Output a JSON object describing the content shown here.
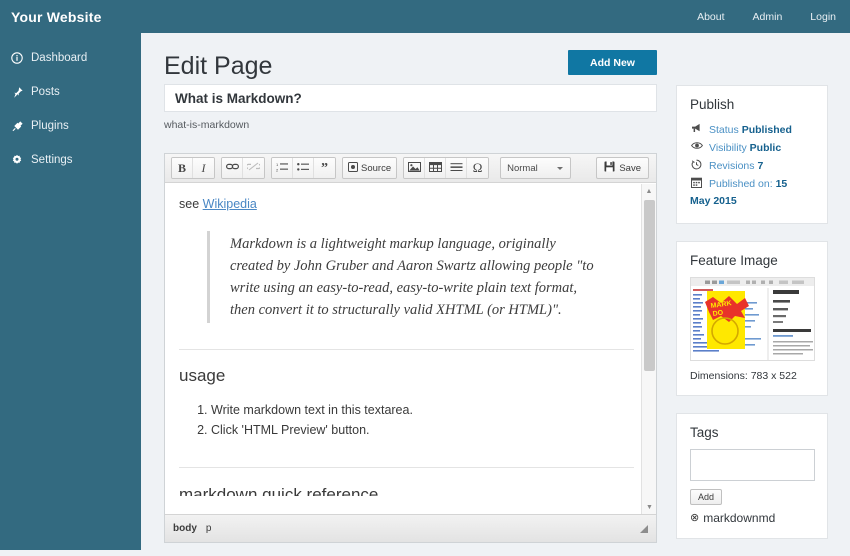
{
  "topbar": {
    "brand": "Your Website",
    "nav": [
      {
        "label": "About"
      },
      {
        "label": "Admin"
      },
      {
        "label": "Login"
      }
    ]
  },
  "sidebar": {
    "items": [
      {
        "label": "Dashboard",
        "icon": "info-circle-icon"
      },
      {
        "label": "Posts",
        "icon": "pushpin-icon"
      },
      {
        "label": "Plugins",
        "icon": "plug-icon"
      },
      {
        "label": "Settings",
        "icon": "gear-icon"
      }
    ]
  },
  "page": {
    "title": "Edit Page",
    "add_new_label": "Add New",
    "post_title": "What is Markdown?",
    "slug": "what-is-markdown"
  },
  "toolbar": {
    "bold": "B",
    "italic": "I",
    "link": "link-icon",
    "unlink": "unlink-icon",
    "numbered_list": "numbered-list-icon",
    "bulleted_list": "bulleted-list-icon",
    "blockquote": "”",
    "source_label": "Source",
    "image": "image-icon",
    "table": "table-icon",
    "hrule": "horizontal-rule-icon",
    "special_char": "Ω",
    "format_value": "Normal",
    "save_label": "Save"
  },
  "editor": {
    "intro_prefix": "see ",
    "intro_link": "Wikipedia",
    "blockquote": "Markdown is a lightweight markup language, originally created by John Gruber and Aaron Swartz allowing people \"to write using an easy-to-read, easy-to-write plain text format, then convert it to structurally valid XHTML (or HTML)\".",
    "usage_heading": "usage",
    "usage_items": [
      "Write markdown text in this textarea.",
      "Click 'HTML Preview' button."
    ],
    "next_heading": "markdown quick reference",
    "status_element": "body",
    "status_child": "p"
  },
  "publish": {
    "heading": "Publish",
    "rows": [
      {
        "icon": "megaphone-icon",
        "label": "Status",
        "value": "Published"
      },
      {
        "icon": "eye-icon",
        "label": "Visibility",
        "value": "Public"
      },
      {
        "icon": "revision-clock-icon",
        "label": "Revisions",
        "value": "7"
      },
      {
        "icon": "calendar-icon",
        "label": "Published on:",
        "value": "15"
      }
    ],
    "date_wrap": "May 2015"
  },
  "feature_image": {
    "heading": "Feature Image",
    "dimensions": "Dimensions: 783 x 522",
    "thumb_alt": "markdown-editor-screenshot-thumbnail"
  },
  "tags": {
    "heading": "Tags",
    "input_value": "",
    "add_label": "Add",
    "items": [
      {
        "name": "markdownmd",
        "remove_icon": "remove-circle-icon"
      }
    ]
  },
  "colors": {
    "brand_teal": "#336a80",
    "accent_blue": "#1077a3",
    "link_blue": "#4a90c4",
    "value_blue": "#16618e",
    "page_bg": "#eff2f5"
  }
}
